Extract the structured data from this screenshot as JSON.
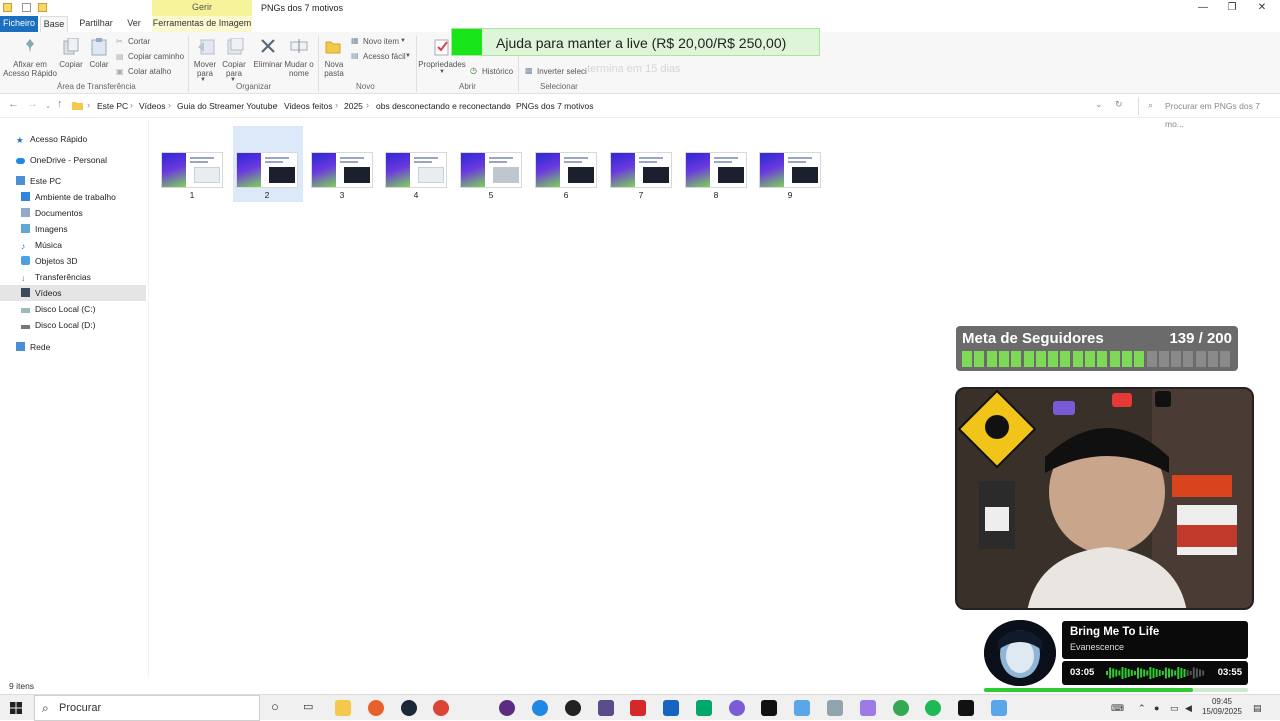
{
  "window": {
    "title": "PNGs dos 7 motivos",
    "context_tab": "Gerir",
    "controls": {
      "minimize": "—",
      "restore": "❐",
      "close": "✕"
    }
  },
  "ribbon_tabs": [
    "Ficheiro",
    "Base",
    "Partilhar",
    "Ver",
    "Ferramentas de Imagem"
  ],
  "ribbon": {
    "pin": "Afixar em Acesso Rápido",
    "copy": "Copiar",
    "paste": "Colar",
    "cut": "Cortar",
    "copy_path": "Copiar caminho",
    "paste_shortcut": "Colar atalho",
    "clipboard_group": "Área de Transferência",
    "move_to": "Mover para",
    "copy_to": "Copiar para",
    "delete": "Eliminar",
    "rename": "Mudar o nome",
    "organize_group": "Organizar",
    "new_folder": "Nova pasta",
    "new_item": "Novo item",
    "easy_access": "Acesso fácil",
    "new_group": "Novo",
    "properties": "Propriedades",
    "history": "Histórico",
    "open_group": "Abrir",
    "invert_selection": "Inverter seleci",
    "select_group": "Selecionar"
  },
  "address": {
    "crumbs": [
      "Este PC",
      "Vídeos",
      "Guia do Streamer Youtube",
      "Videos feitos",
      "2025",
      "obs desconectando e reconectando",
      "PNGs dos 7 motivos"
    ],
    "search_placeholder": "Procurar em PNGs dos 7 mo..."
  },
  "nav": {
    "quick_access": "Acesso Rápido",
    "onedrive": "OneDrive - Personal",
    "this_pc": "Este PC",
    "desktop": "Ambiente de trabalho",
    "documents": "Documentos",
    "images": "Imagens",
    "music": "Música",
    "objects3d": "Objetos 3D",
    "downloads": "Transferências",
    "videos": "Vídeos",
    "disk_c": "Disco Local (C:)",
    "disk_d": "Disco Local (D:)",
    "network": "Rede"
  },
  "files": [
    {
      "name": "1",
      "variant": "light"
    },
    {
      "name": "2",
      "variant": "dark"
    },
    {
      "name": "3",
      "variant": "dark"
    },
    {
      "name": "4",
      "variant": "light"
    },
    {
      "name": "5",
      "variant": "mid"
    },
    {
      "name": "6",
      "variant": "dark"
    },
    {
      "name": "7",
      "variant": "dark"
    },
    {
      "name": "8",
      "variant": "dark"
    },
    {
      "name": "9",
      "variant": "dark"
    }
  ],
  "status_bar": {
    "count": "9 itens"
  },
  "overlay": {
    "donation": "Ajuda para manter a live (R$ 20,00/R$ 250,00)",
    "donation_note": "termina em 15 dias",
    "goal_title": "Meta de Seguidores",
    "goal_value": "139 / 200",
    "goal_progress": 0.695,
    "song_title": "Bring Me To Life",
    "song_artist": "Evanescence",
    "time_elapsed": "03:05",
    "time_total": "03:55",
    "song_progress": 0.79,
    "accent": "#2ecc2e"
  },
  "taskbar": {
    "search": "Procurar",
    "time": "09:45",
    "date": "15/09/2025"
  }
}
